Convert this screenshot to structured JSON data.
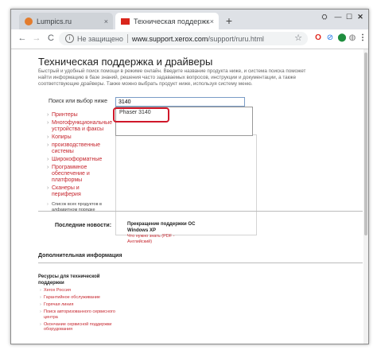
{
  "browser": {
    "tabs": [
      {
        "title": "Lumpics.ru",
        "close": "×"
      },
      {
        "title": "Техническая поддержка и драйве",
        "close": "×"
      }
    ],
    "new_tab": "+",
    "window_controls": {
      "user": "⛭",
      "minimize": "—",
      "maximize": "☐",
      "close": "✕"
    },
    "nav": {
      "back": "←",
      "forward": "→",
      "reload": "C"
    },
    "address": {
      "security_text": "Не защищено",
      "url_domain": "www.support.xerox.com",
      "url_path": "/support/ruru.html",
      "star": "☆"
    },
    "extensions": {
      "opera": "O",
      "adblock": "⊘",
      "green": "⬤",
      "globe": "◍",
      "menu": "⋮"
    }
  },
  "page": {
    "title": "Техническая поддержка и драйверы",
    "intro": "Быстрый и удобный поиск помощи в режиме онлайн. Введите название продукта ниже, и система поиска поможет найти информацию в базе знаний, решения часто задаваемых вопросов, инструкции и документации, а также соответствующие драйверы. Также можно выбрать продукт ниже, используя систему меню.",
    "search": {
      "label": "Поиск или выбор ниже",
      "value": "3140",
      "suggestion": "Phaser 3140"
    },
    "categories": [
      "Принтеры",
      "Многофункциональные устройства и факсы",
      "Копиры",
      "производственные системы",
      "Широкоформатные",
      "Программное обеспечение и платформы",
      "Сканеры и периферия"
    ],
    "alphabet_link": "Список всех продуктов в алфавитном порядке",
    "news": {
      "label": "Последние новости:",
      "title": "Прекращение поддержки ОС Windows XP",
      "link": "Что нужно знать (PDF - Английский)"
    },
    "more_info": {
      "title": "Дополнительная информация",
      "resources_title": "Ресурсы для технической поддержки",
      "items": [
        "Xerox Россия",
        "Гарантийное обслуживание",
        "Горячая линия",
        "Поиск авторизованного сервисного центра",
        "Окончание сервисной поддержки оборудования"
      ]
    }
  }
}
